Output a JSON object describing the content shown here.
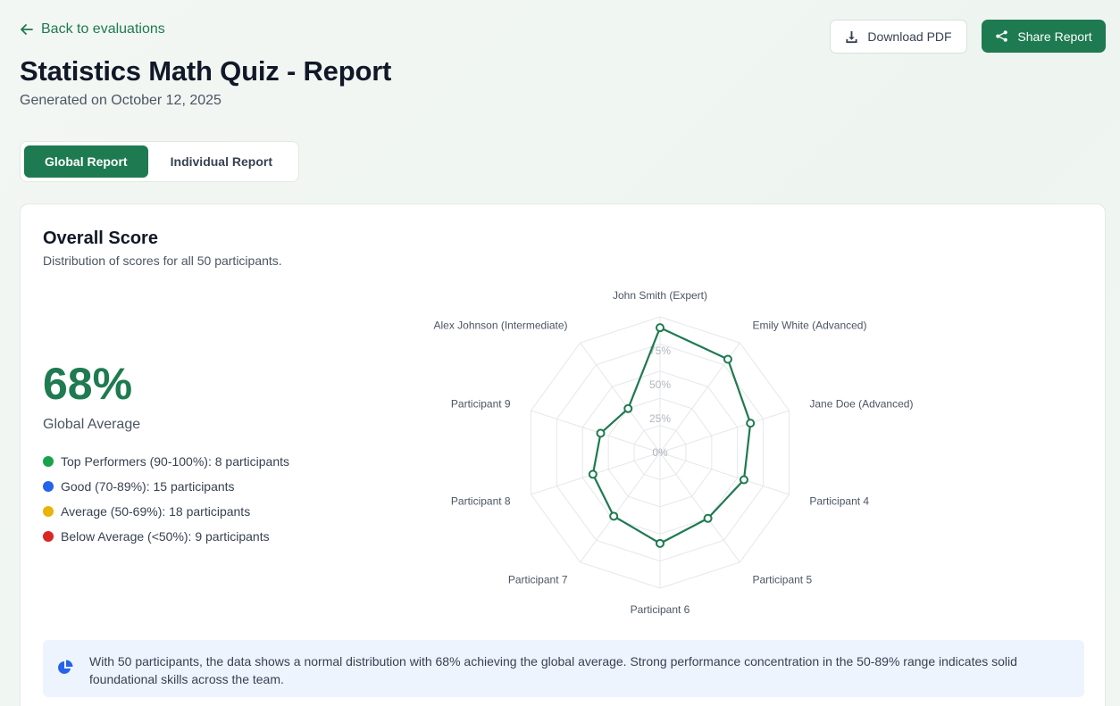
{
  "nav": {
    "back_label": "Back to evaluations"
  },
  "header": {
    "title": "Statistics Math Quiz - Report",
    "subtitle": "Generated on October 12, 2025",
    "download_label": "Download PDF",
    "share_label": "Share Report"
  },
  "tabs": [
    {
      "label": "Global Report",
      "active": true
    },
    {
      "label": "Individual Report",
      "active": false
    }
  ],
  "card": {
    "title": "Overall Score",
    "subtitle": "Distribution of scores for all 50 participants.",
    "big_value": "68%",
    "big_label": "Global Average",
    "legend": [
      {
        "label": "Top Performers (90-100%): 8 participants",
        "color": "#16a34a"
      },
      {
        "label": "Good (70-89%): 15 participants",
        "color": "#2563eb"
      },
      {
        "label": "Average (50-69%): 18 participants",
        "color": "#eab308"
      },
      {
        "label": "Below Average (<50%): 9 participants",
        "color": "#dc2626"
      }
    ],
    "insight": "With 50 participants, the data shows a normal distribution with 68% achieving the global average. Strong performance concentration in the 50-89% range indicates solid foundational skills across the team."
  },
  "colors": {
    "accent": "#1e7a50",
    "insight_bg": "#eef4fe",
    "info_icon": "#2563eb"
  },
  "icons": {
    "back": "arrow-left-icon",
    "download": "download-icon",
    "share": "share-icon",
    "insight": "pie-chart-icon"
  },
  "chart_data": {
    "type": "radar",
    "categories": [
      "John Smith (Expert)",
      "Emily White (Advanced)",
      "Jane Doe (Advanced)",
      "Participant 4",
      "Participant 5",
      "Participant 6",
      "Participant 7",
      "Participant 8",
      "Participant 9",
      "Alex Johnson (Intermediate)"
    ],
    "values": [
      92,
      85,
      70,
      65,
      60,
      67,
      58,
      52,
      46,
      40
    ],
    "rlim": [
      0,
      100
    ],
    "ticks": [
      "0%",
      "25%",
      "50%",
      "75%"
    ],
    "tick_values": [
      0,
      25,
      50,
      75
    ],
    "series_color": "#1e7a50",
    "grid": true
  }
}
